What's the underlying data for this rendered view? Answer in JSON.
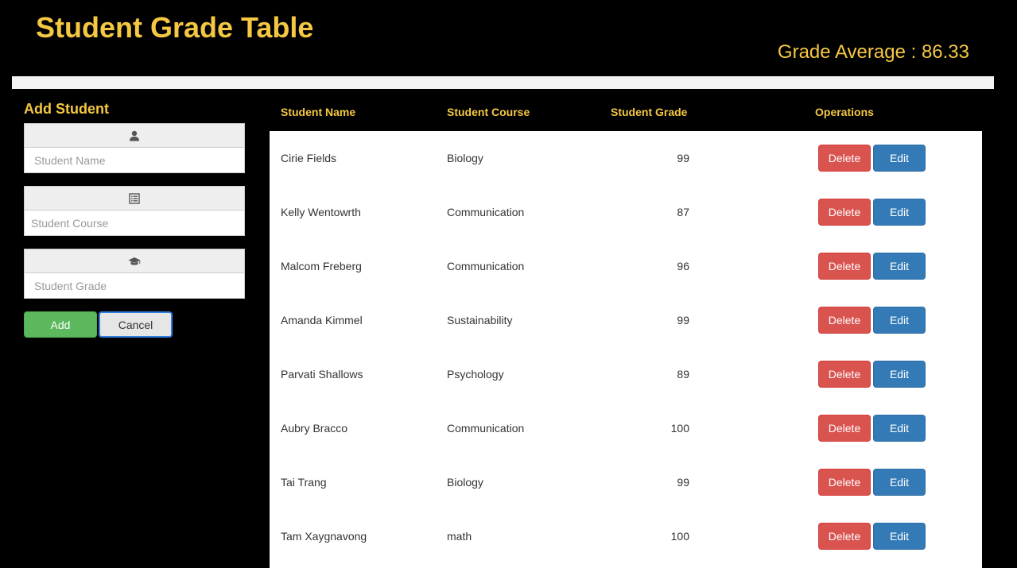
{
  "header": {
    "title": "Student Grade Table",
    "average_label": "Grade Average",
    "average_separator": " : ",
    "average_value": "86.33"
  },
  "form": {
    "heading": "Add Student",
    "name_icon": "user-icon",
    "name_placeholder": "Student Name",
    "course_icon": "list-alt-icon",
    "course_placeholder": "Student Course",
    "grade_icon": "education-icon",
    "grade_placeholder": "Student Grade",
    "add_label": "Add",
    "cancel_label": "Cancel"
  },
  "table": {
    "headers": {
      "name": "Student Name",
      "course": "Student Course",
      "grade": "Student Grade",
      "operations": "Operations"
    },
    "delete_label": "Delete",
    "edit_label": "Edit",
    "rows": [
      {
        "name": "Cirie Fields",
        "course": "Biology",
        "grade": "99"
      },
      {
        "name": "Kelly Wentowrth",
        "course": "Communication",
        "grade": "87"
      },
      {
        "name": "Malcom Freberg",
        "course": "Communication",
        "grade": "96"
      },
      {
        "name": "Amanda Kimmel",
        "course": "Sustainability",
        "grade": "99"
      },
      {
        "name": "Parvati Shallows",
        "course": "Psychology",
        "grade": "89"
      },
      {
        "name": "Aubry Bracco",
        "course": "Communication",
        "grade": "100"
      },
      {
        "name": "Tai Trang",
        "course": "Biology",
        "grade": "99"
      },
      {
        "name": "Tam Xaygnavong",
        "course": "math",
        "grade": "100"
      }
    ]
  },
  "colors": {
    "accent": "#f5c842",
    "add_button": "#5cb85c",
    "delete_button": "#d9534f",
    "edit_button": "#337ab7"
  }
}
